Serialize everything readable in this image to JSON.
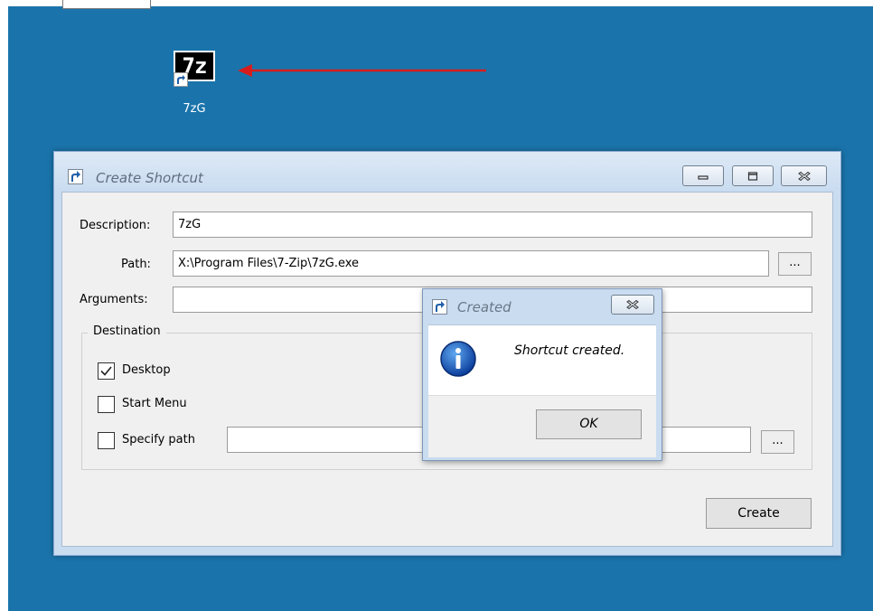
{
  "desktop": {
    "icon_logo_text": "7z",
    "icon_label": "7zG",
    "background_color": "#1a74ab",
    "annotation_color": "#d81c1c"
  },
  "window": {
    "title": "Create Shortcut",
    "fields": {
      "description_label": "Description:",
      "description_value": "7zG",
      "path_label": "Path:",
      "path_value": "X:\\Program Files\\7-Zip\\7zG.exe",
      "arguments_label": "Arguments:",
      "arguments_value": "",
      "browse_label": "..."
    },
    "destination": {
      "title": "Destination",
      "desktop_label": "Desktop",
      "desktop_checked": true,
      "start_menu_label": "Start Menu",
      "start_menu_checked": false,
      "specify_path_label": "Specify path",
      "specify_path_checked": false,
      "specify_path_value": "",
      "browse_label": "..."
    },
    "create_label": "Create"
  },
  "dialog": {
    "title": "Created",
    "message": "Shortcut created.",
    "ok_label": "OK"
  }
}
